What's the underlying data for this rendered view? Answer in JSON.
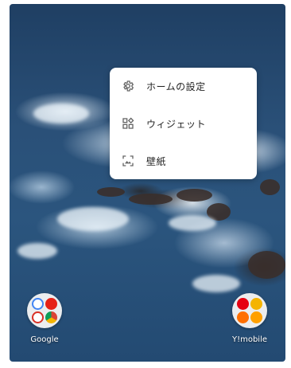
{
  "context_menu": {
    "items": [
      {
        "label": "ホームの設定",
        "icon": "gear-icon"
      },
      {
        "label": "ウィジェット",
        "icon": "widgets-icon"
      },
      {
        "label": "壁紙",
        "icon": "wallpaper-icon"
      }
    ]
  },
  "home_folders": [
    {
      "label": "Google"
    },
    {
      "label": "Y!mobile"
    }
  ],
  "colors": {
    "menu_background": "#ffffff",
    "menu_text": "#222222",
    "icon_gray": "#666666",
    "ocean": "#2a5078"
  }
}
